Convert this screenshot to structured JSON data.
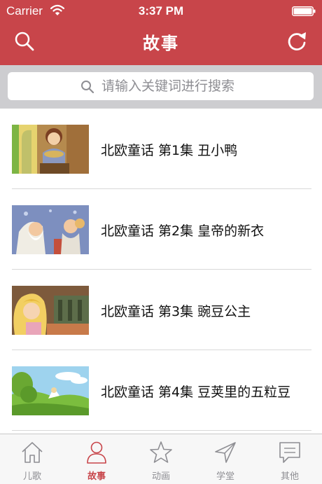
{
  "status": {
    "carrier": "Carrier",
    "time": "3:37 PM"
  },
  "nav": {
    "title": "故事",
    "left_icon": "search-icon",
    "right_icon": "refresh-icon"
  },
  "search": {
    "placeholder": "请输入关键词进行搜索"
  },
  "items": [
    {
      "title": "北欧童话 第1集 丑小鸭"
    },
    {
      "title": "北欧童话 第2集 皇帝的新衣"
    },
    {
      "title": "北欧童话 第3集 豌豆公主"
    },
    {
      "title": "北欧童话 第4集 豆荚里的五粒豆"
    }
  ],
  "tabs": [
    {
      "label": "儿歌",
      "icon": "house-icon"
    },
    {
      "label": "故事",
      "icon": "person-icon",
      "active": true
    },
    {
      "label": "动画",
      "icon": "star-icon"
    },
    {
      "label": "学堂",
      "icon": "navigation-arrow-icon"
    },
    {
      "label": "其他",
      "icon": "chat-bubble-icon"
    }
  ],
  "colors": {
    "primary": "#c8454a",
    "tab_inactive": "#8e8e93",
    "search_bg": "#cdcdd0"
  }
}
